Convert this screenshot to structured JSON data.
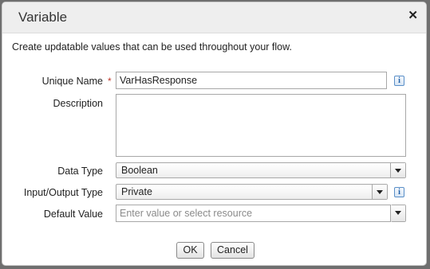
{
  "dialog": {
    "title": "Variable",
    "description": "Create updatable values that can be used throughout your flow."
  },
  "form": {
    "unique_name": {
      "label": "Unique Name",
      "required_marker": "*",
      "value": "VarHasResponse"
    },
    "description": {
      "label": "Description",
      "value": ""
    },
    "data_type": {
      "label": "Data Type",
      "value": "Boolean"
    },
    "input_output_type": {
      "label": "Input/Output Type",
      "value": "Private"
    },
    "default_value": {
      "label": "Default Value",
      "placeholder": "Enter value or select resource"
    }
  },
  "buttons": {
    "ok": "OK",
    "cancel": "Cancel"
  },
  "icons": {
    "close": "close-icon",
    "info": "info-icon",
    "dropdown": "chevron-down-icon"
  },
  "colors": {
    "required": "#c0392b",
    "info": "#1e5fa8"
  }
}
